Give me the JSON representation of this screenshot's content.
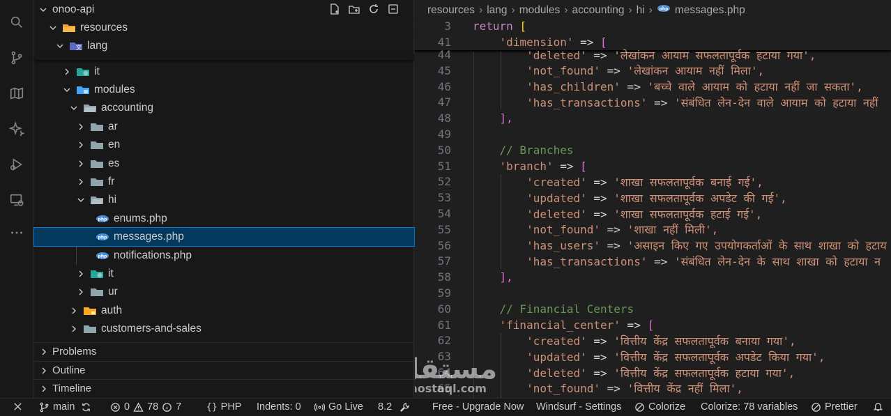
{
  "explorer": {
    "root_label": "onoo-api",
    "items": [
      {
        "label": "resources"
      },
      {
        "label": "lang"
      },
      {
        "label": "it"
      },
      {
        "label": "modules"
      },
      {
        "label": "accounting"
      },
      {
        "label": "ar"
      },
      {
        "label": "en"
      },
      {
        "label": "es"
      },
      {
        "label": "fr"
      },
      {
        "label": "hi"
      },
      {
        "label": "enums.php"
      },
      {
        "label": "messages.php"
      },
      {
        "label": "notifications.php"
      },
      {
        "label": "it"
      },
      {
        "label": "ur"
      },
      {
        "label": "auth"
      },
      {
        "label": "customers-and-sales"
      }
    ],
    "panels": [
      "Problems",
      "Outline",
      "Timeline"
    ]
  },
  "breadcrumb": [
    "resources",
    "lang",
    "modules",
    "accounting",
    "hi",
    "messages.php"
  ],
  "code": {
    "sticky": [
      {
        "ln": "3",
        "text": "return ["
      },
      {
        "ln": "41",
        "text": "    'dimension' => ["
      }
    ],
    "lines": [
      {
        "ln": "44",
        "key": "'deleted'",
        "val": "'लेखांकन आयाम सफलतापूर्वक हटाया गया',"
      },
      {
        "ln": "45",
        "key": "'not_found'",
        "val": "'लेखांकन आयाम नहीं मिला',"
      },
      {
        "ln": "46",
        "key": "'has_children'",
        "val": "'बच्चे वाले आयाम को हटाया नहीं जा सकता',"
      },
      {
        "ln": "47",
        "key": "'has_transactions'",
        "val": "'संबंधित लेन-देन वाले आयाम को हटाया नहीं"
      },
      {
        "ln": "48",
        "close": "],"
      },
      {
        "ln": "49"
      },
      {
        "ln": "50",
        "comment": "// Branches"
      },
      {
        "ln": "51",
        "key": "'branch'",
        "open": "["
      },
      {
        "ln": "52",
        "key": "'created'",
        "val": "'शाखा सफलतापूर्वक बनाई गई',"
      },
      {
        "ln": "53",
        "key": "'updated'",
        "val": "'शाखा सफलतापूर्वक अपडेट की गई',"
      },
      {
        "ln": "54",
        "key": "'deleted'",
        "val": "'शाखा सफलतापूर्वक हटाई गई',"
      },
      {
        "ln": "55",
        "key": "'not_found'",
        "val": "'शाखा नहीं मिली',"
      },
      {
        "ln": "56",
        "key": "'has_users'",
        "val": "'असाइन किए गए उपयोगकर्ताओं के साथ शाखा को हटाय"
      },
      {
        "ln": "57",
        "key": "'has_transactions'",
        "val": "'संबंधित लेन-देन के साथ शाखा को हटाया न"
      },
      {
        "ln": "58",
        "close": "],"
      },
      {
        "ln": "59"
      },
      {
        "ln": "60",
        "comment": "// Financial Centers"
      },
      {
        "ln": "61",
        "key": "'financial_center'",
        "open": "["
      },
      {
        "ln": "62",
        "key": "'created'",
        "val": "'वित्तीय केंद्र सफलतापूर्वक बनाया गया',"
      },
      {
        "ln": "63",
        "key": "'updated'",
        "val": "'वित्तीय केंद्र सफलतापूर्वक अपडेट किया गया',"
      },
      {
        "ln": "64",
        "key": "'deleted'",
        "val": "'वित्तीय केंद्र सफलतापूर्वक हटाया गया',"
      },
      {
        "ln": "65",
        "key": "'not_found'",
        "val": "'वित्तीय केंद्र नहीं मिला',"
      }
    ]
  },
  "status": {
    "branch": "main",
    "errors": "0",
    "warnings": "78",
    "info": "7",
    "language": "PHP",
    "indents": "Indents: 0",
    "golive": "Go Live",
    "version": "8.2",
    "upgrade": "Free - Upgrade Now",
    "windsurf": "Windsurf - Settings",
    "colorize": "Colorize",
    "colorize_vars": "Colorize: 78 variables",
    "prettier": "Prettier"
  },
  "watermark": {
    "big": "مستقل",
    "small": "mostaql.com"
  },
  "colors": {
    "selection": "#04395e",
    "accent": "#0078d4",
    "keyword": "#c586c0",
    "string": "#ce9178",
    "comment": "#6a9955"
  }
}
